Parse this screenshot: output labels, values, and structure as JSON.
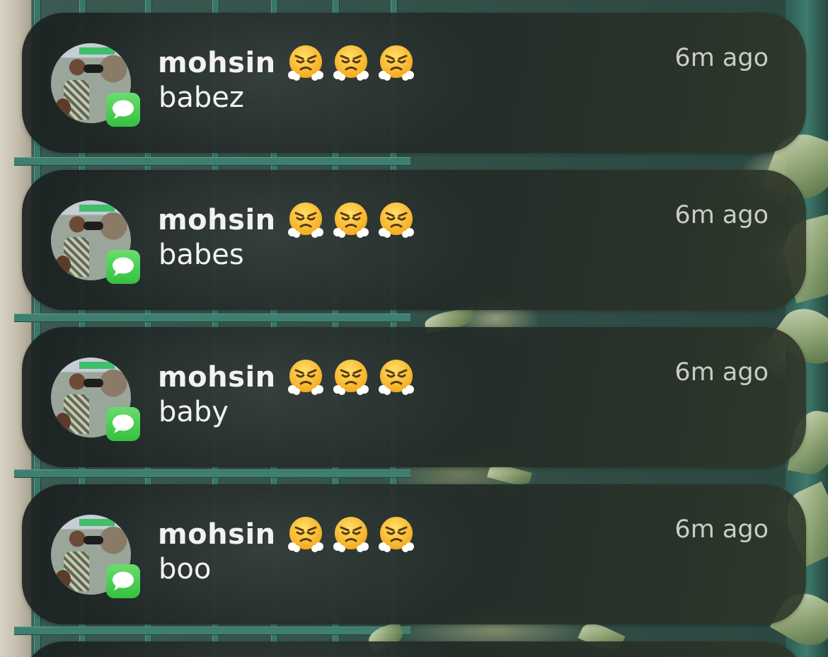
{
  "notifications": [
    {
      "sender": "mohsin",
      "emoji": "face-with-steam-from-nose",
      "time": "6m ago",
      "message": "babez",
      "app_icon": "messages-icon"
    },
    {
      "sender": "mohsin",
      "emoji": "face-with-steam-from-nose",
      "time": "6m ago",
      "message": "babes",
      "app_icon": "messages-icon"
    },
    {
      "sender": "mohsin",
      "emoji": "face-with-steam-from-nose",
      "time": "6m ago",
      "message": "baby",
      "app_icon": "messages-icon"
    },
    {
      "sender": "mohsin",
      "emoji": "face-with-steam-from-nose",
      "time": "6m ago",
      "message": "boo",
      "app_icon": "messages-icon"
    }
  ],
  "colors": {
    "card_background": "#1e2624",
    "sender_text": "#f2f2f2",
    "time_text": "#c9cdc6",
    "messages_green": "#34c03f"
  }
}
